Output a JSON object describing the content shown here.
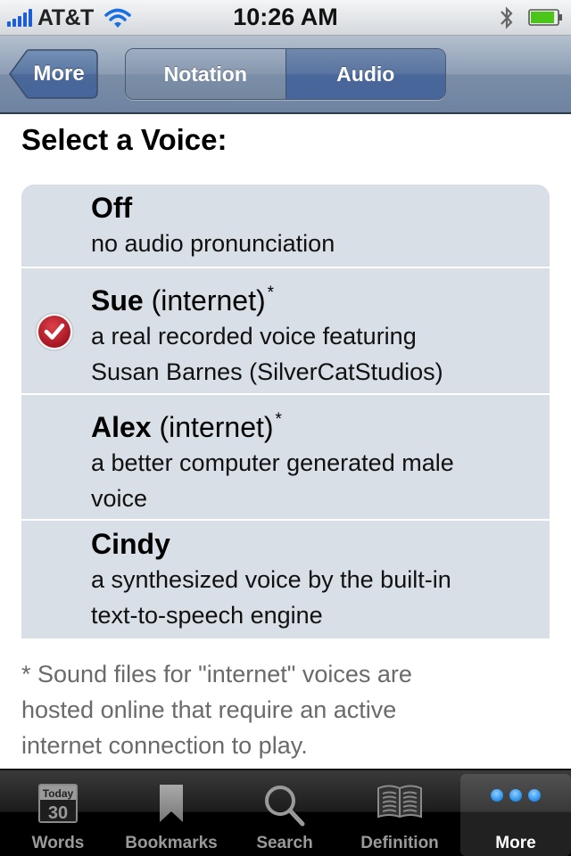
{
  "status_bar": {
    "carrier": "AT&T",
    "time": "10:26 AM",
    "signal_bars": 5,
    "wifi": true,
    "bluetooth": true,
    "battery_level": 0.9,
    "battery_color": "#4cc51a"
  },
  "nav": {
    "back_label": "More",
    "segments": [
      {
        "label": "Notation",
        "selected": false
      },
      {
        "label": "Audio",
        "selected": true
      }
    ]
  },
  "content": {
    "heading": "Select a Voice:",
    "voices": [
      {
        "name": "Off",
        "qualifier": "",
        "asterisk": "",
        "description_lines": [
          "no audio pronunciation"
        ],
        "selected": false
      },
      {
        "name": "Sue",
        "qualifier": "(internet)",
        "asterisk": "*",
        "description_lines": [
          "a real recorded voice featuring",
          "Susan Barnes (SilverCatStudios)"
        ],
        "selected": true
      },
      {
        "name": "Alex",
        "qualifier": "(internet)",
        "asterisk": "*",
        "description_lines": [
          "a better computer generated male",
          "voice"
        ],
        "selected": false
      },
      {
        "name": "Cindy",
        "qualifier": "",
        "asterisk": "",
        "description_lines": [
          "a synthesized voice by the built-in",
          "text-to-speech engine"
        ],
        "selected": false
      }
    ],
    "footnote_lines": [
      "* Sound files for \"internet\" voices are",
      "hosted online that require an active",
      "internet connection to play."
    ]
  },
  "tab_bar": {
    "tabs": [
      {
        "label": "Words",
        "icon": "calendar-today-icon",
        "icon_text_top": "Today",
        "icon_text_num": "30",
        "active": false
      },
      {
        "label": "Bookmarks",
        "icon": "bookmark-icon",
        "active": false
      },
      {
        "label": "Search",
        "icon": "search-icon",
        "active": false
      },
      {
        "label": "Definition",
        "icon": "open-book-icon",
        "active": false
      },
      {
        "label": "More",
        "icon": "more-dots-icon",
        "active": true
      }
    ],
    "more_dots_color": "#3aa2f5"
  }
}
